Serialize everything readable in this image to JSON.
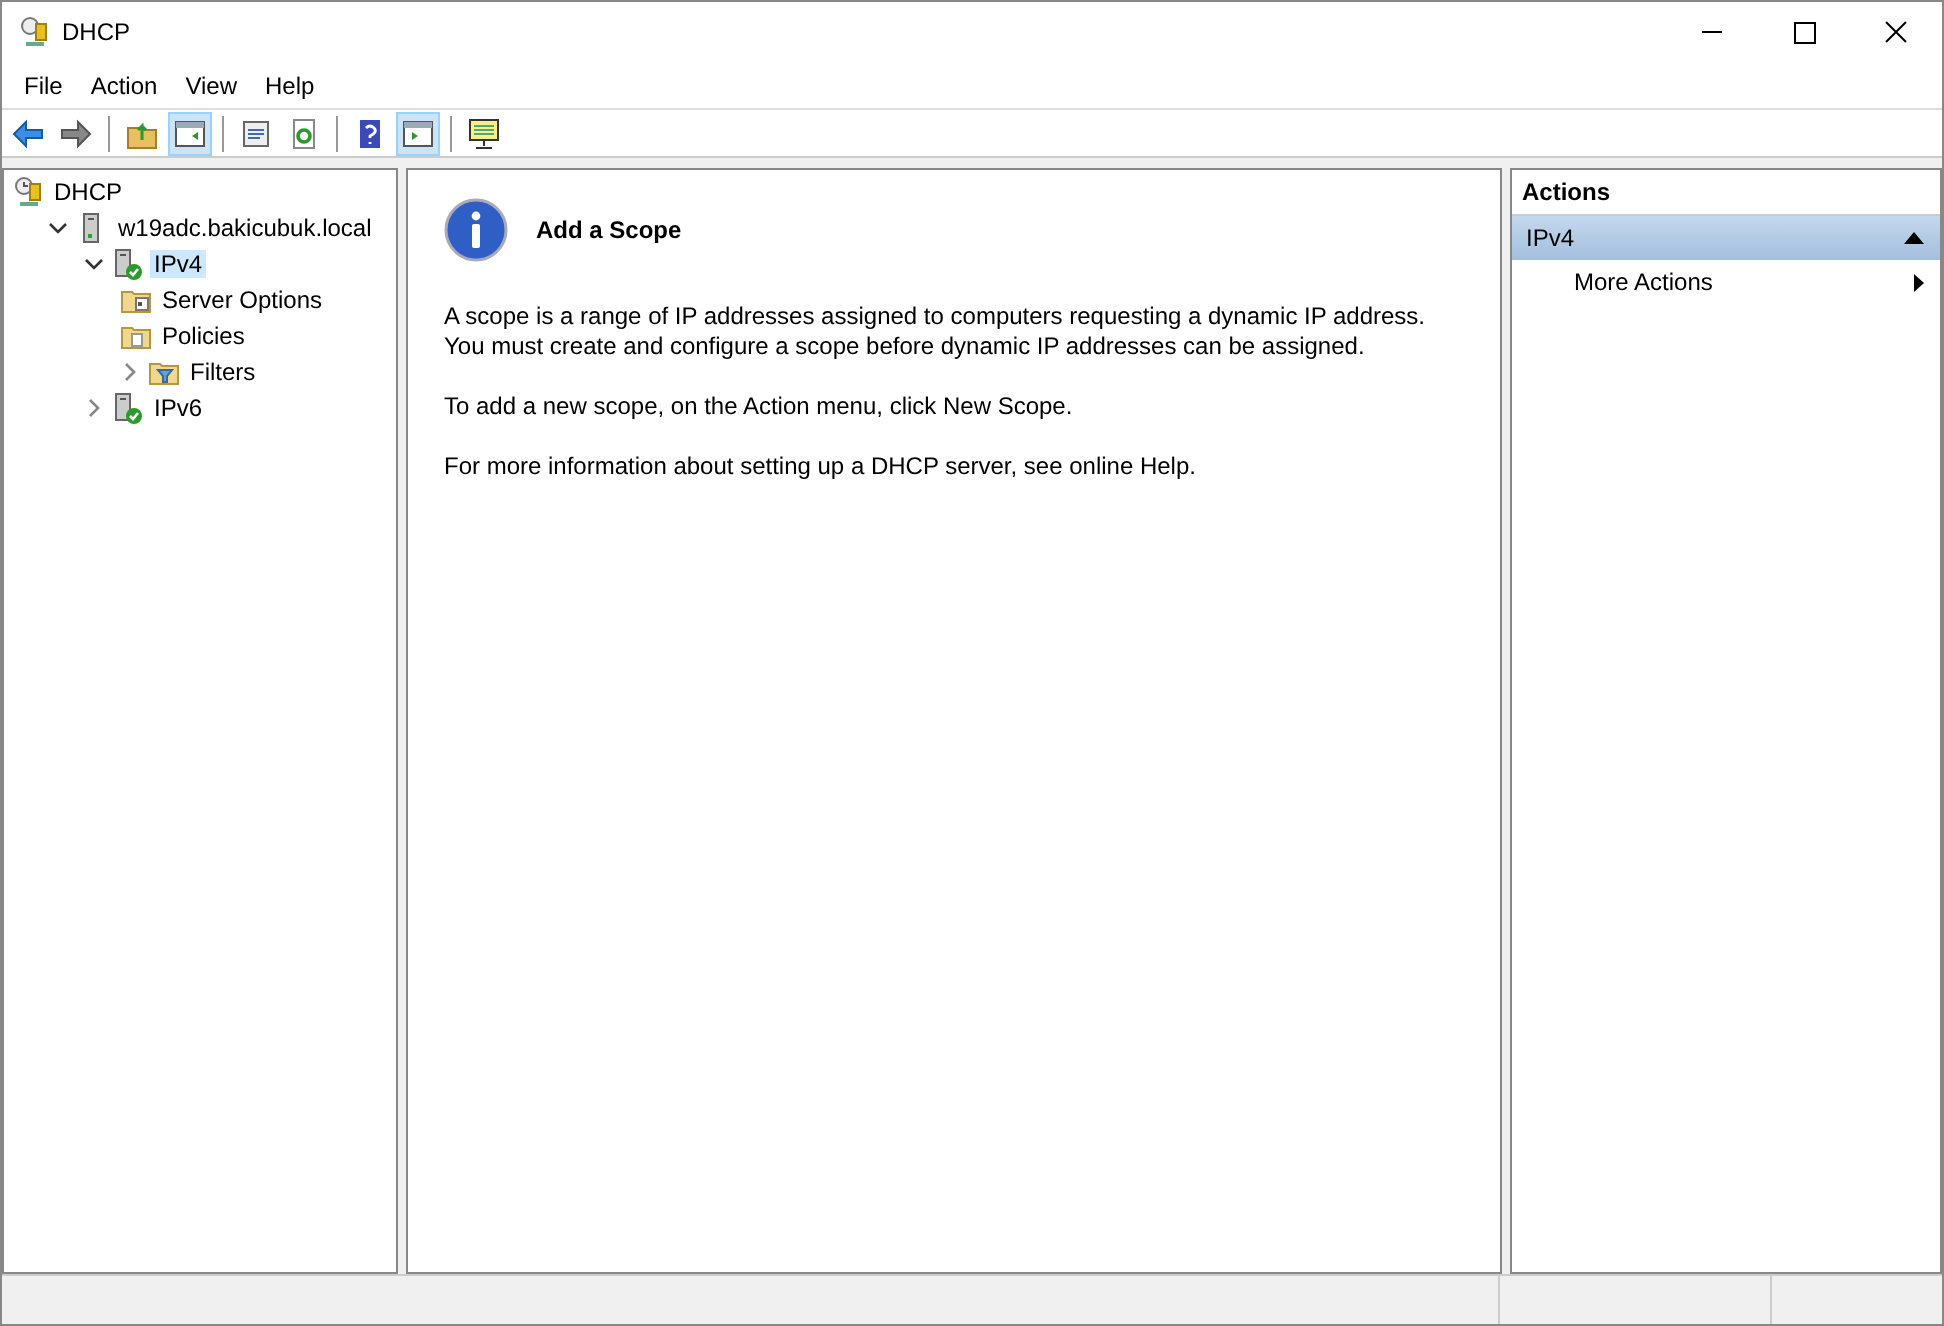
{
  "window": {
    "title": "DHCP"
  },
  "menu": [
    "File",
    "Action",
    "View",
    "Help"
  ],
  "toolbar": [
    {
      "kind": "back",
      "pressed": false
    },
    {
      "kind": "forward",
      "pressed": false
    },
    {
      "kind": "sep"
    },
    {
      "kind": "up",
      "pressed": false
    },
    {
      "kind": "tree",
      "pressed": true
    },
    {
      "kind": "sep"
    },
    {
      "kind": "properties",
      "pressed": false
    },
    {
      "kind": "refresh",
      "pressed": false
    },
    {
      "kind": "sep"
    },
    {
      "kind": "help",
      "pressed": false
    },
    {
      "kind": "actionpane",
      "pressed": true
    },
    {
      "kind": "sep"
    },
    {
      "kind": "monitor",
      "pressed": false
    }
  ],
  "tree": [
    {
      "label": "DHCP",
      "kind": "dhcp",
      "selected": false,
      "children": [
        {
          "label": "w19adc.bakicubuk.local",
          "kind": "server",
          "expanded": true,
          "selected": false,
          "children": [
            {
              "label": "IPv4",
              "kind": "protocol",
              "expanded": true,
              "selected": true,
              "children": [
                {
                  "label": "Server Options",
                  "kind": "options",
                  "selected": false
                },
                {
                  "label": "Policies",
                  "kind": "policies",
                  "selected": false
                },
                {
                  "label": "Filters",
                  "kind": "filters",
                  "expanded": false,
                  "selected": false
                }
              ]
            },
            {
              "label": "IPv6",
              "kind": "protocol",
              "expanded": false,
              "selected": false
            }
          ]
        }
      ]
    }
  ],
  "content": {
    "title": "Add a Scope",
    "paragraphs": [
      "A scope is a range of IP addresses assigned to computers requesting a dynamic IP address.\nYou must create and configure a scope before dynamic IP addresses can be assigned.",
      "To add a new scope, on the Action menu, click New Scope.",
      "For more information about setting up a DHCP server, see online Help."
    ]
  },
  "actions": {
    "title": "Actions",
    "sections": [
      {
        "label": "IPv4",
        "expanded": true,
        "items": [
          "More Actions"
        ]
      }
    ]
  }
}
